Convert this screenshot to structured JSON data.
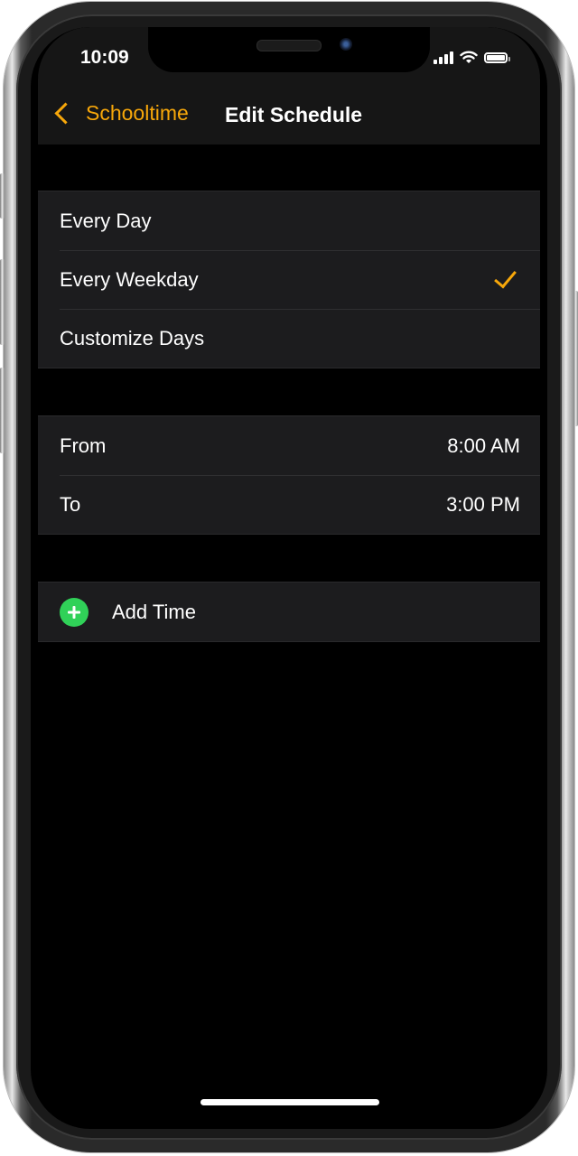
{
  "status_bar": {
    "time": "10:09",
    "signal": "signal-icon",
    "wifi": "wifi-icon",
    "battery": "battery-icon"
  },
  "nav": {
    "back_label": "Schooltime",
    "title": "Edit Schedule"
  },
  "repeat_options": [
    {
      "label": "Every Day",
      "selected": false
    },
    {
      "label": "Every Weekday",
      "selected": true
    },
    {
      "label": "Customize Days",
      "selected": false
    }
  ],
  "time_range": [
    {
      "label": "From",
      "value": "8:00 AM"
    },
    {
      "label": "To",
      "value": "3:00 PM"
    }
  ],
  "add_time": {
    "label": "Add Time"
  },
  "colors": {
    "accent": "#f7a70a",
    "add": "#30d158",
    "row_bg": "#1c1c1e",
    "background": "#000000"
  }
}
